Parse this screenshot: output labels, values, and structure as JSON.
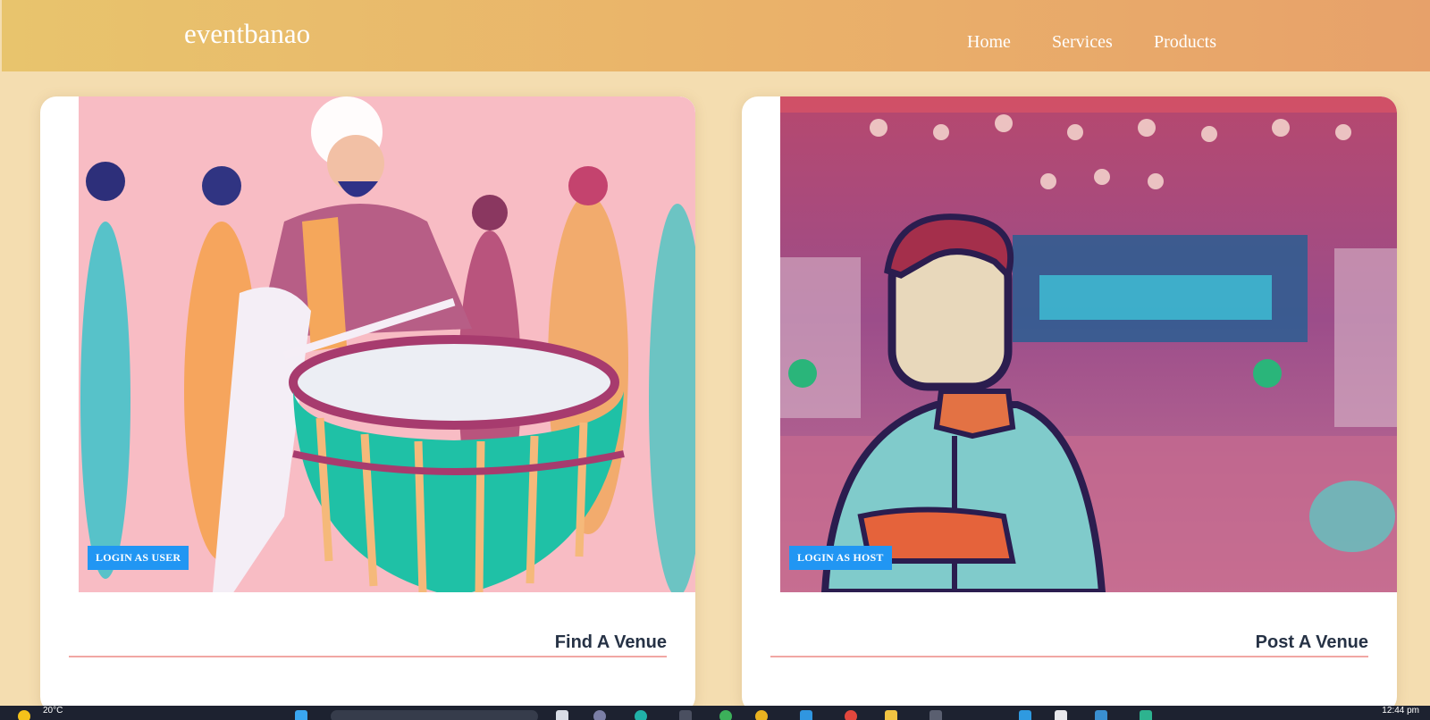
{
  "header": {
    "brand": "eventbanao",
    "nav": [
      "Home",
      "Services",
      "Products"
    ]
  },
  "cards": [
    {
      "badge": "LOGIN AS USER",
      "title": "Find A Venue",
      "image": "dhol-drummer-illustration"
    },
    {
      "badge": "LOGIN AS HOST",
      "title": "Post A Venue",
      "image": "host-man-banquet-hall-illustration"
    }
  ],
  "taskbar": {
    "weather": "20°C",
    "time": "12:44 pm"
  },
  "colors": {
    "header_gradient_start": "#e8c46d",
    "header_gradient_end": "#e7a16a",
    "page_bg": "#f4ddb0",
    "badge": "#2196f3",
    "title": "#263245",
    "underline": "#f1a7a4"
  }
}
